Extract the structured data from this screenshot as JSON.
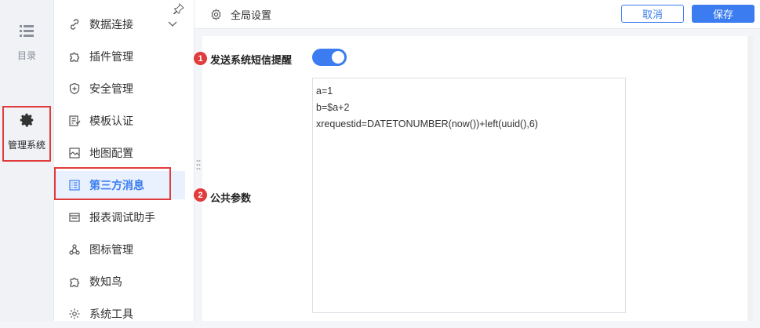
{
  "rail": {
    "catalog_label": "目录",
    "system_label": "管理系统"
  },
  "sidebar": {
    "items": [
      {
        "label": "数据连接",
        "icon": "link-icon"
      },
      {
        "label": "插件管理",
        "icon": "puzzle-icon"
      },
      {
        "label": "安全管理",
        "icon": "shield-icon"
      },
      {
        "label": "模板认证",
        "icon": "template-cert-icon"
      },
      {
        "label": "地图配置",
        "icon": "map-icon"
      },
      {
        "label": "第三方消息",
        "icon": "message-list-icon"
      },
      {
        "label": "报表调试助手",
        "icon": "report-debug-icon"
      },
      {
        "label": "图标管理",
        "icon": "icon-manage-icon"
      },
      {
        "label": "数知鸟",
        "icon": "puzzle-icon"
      },
      {
        "label": "系统工具",
        "icon": "gear-icon"
      }
    ],
    "active_index": 5
  },
  "topbar": {
    "title": "全局设置",
    "cancel_label": "取消",
    "save_label": "保存"
  },
  "form": {
    "badge1": "1",
    "sms_label": "发送系统短信提醒",
    "sms_enabled": true,
    "badge2": "2",
    "params_label": "公共参数",
    "params_lines": [
      "a=1",
      "b=$a+2",
      "xrequestid=DATETONUMBER(now())+left(uuid(),6)"
    ]
  },
  "colors": {
    "accent": "#3b7cf0",
    "highlight": "#e23b3b",
    "active_bg": "#e8f1fd"
  }
}
